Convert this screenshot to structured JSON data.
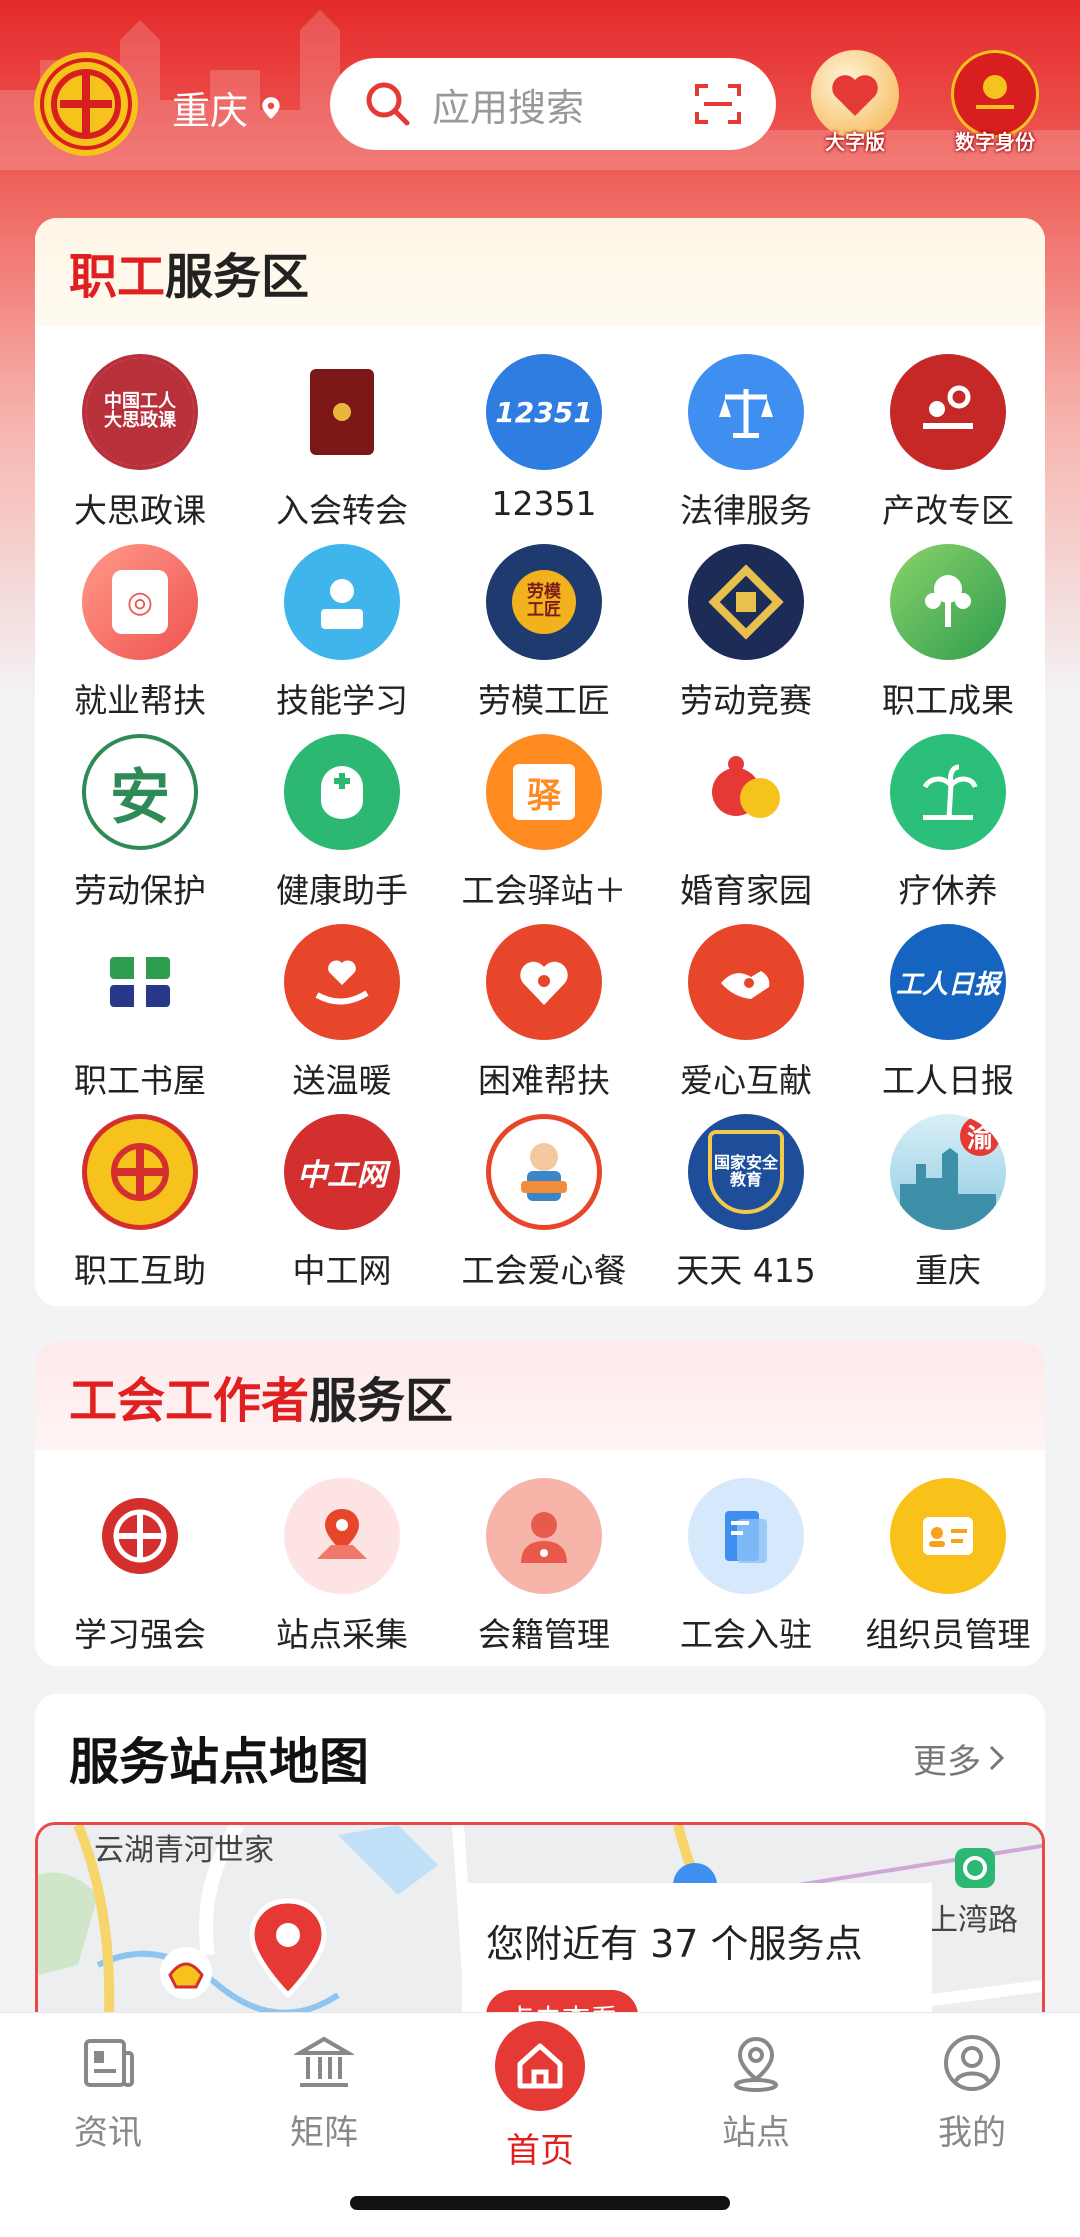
{
  "header": {
    "city": "重庆",
    "search_placeholder": "应用搜索",
    "large_font_label": "大字版",
    "digital_id_label": "数字身份"
  },
  "worker_zone": {
    "title_red": "职工",
    "title_rest": "服务区",
    "items": [
      {
        "label": "大思政课",
        "icon": "ideology-course-icon",
        "text": "中国工人大思政课",
        "color": "#b8303a"
      },
      {
        "label": "入会转会",
        "icon": "membership-book-icon",
        "color": "#8b1a1a"
      },
      {
        "label": "12351",
        "icon": "hotline-12351-icon",
        "text": "12351",
        "color": "#2f7de1"
      },
      {
        "label": "法律服务",
        "icon": "scale-icon",
        "color": "#3f8ff0"
      },
      {
        "label": "产改专区",
        "icon": "industry-reform-icon",
        "color": "#c62828"
      },
      {
        "label": "就业帮扶",
        "icon": "employment-icon",
        "color": "#f26d6d"
      },
      {
        "label": "技能学习",
        "icon": "skill-learning-icon",
        "color": "#3fb5ec"
      },
      {
        "label": "劳模工匠",
        "icon": "model-worker-medal-icon",
        "text": "劳模工匠",
        "color": "#1e3a6e"
      },
      {
        "label": "劳动竞赛",
        "icon": "labor-contest-icon",
        "color": "#1d2b57"
      },
      {
        "label": "职工成果",
        "icon": "worker-achievement-icon",
        "color": "#4caf50"
      },
      {
        "label": "劳动保护",
        "icon": "labor-protection-icon",
        "text": "安",
        "color": "#2e8b57"
      },
      {
        "label": "健康助手",
        "icon": "health-assistant-icon",
        "color": "#2cb872"
      },
      {
        "label": "工会驿站＋",
        "icon": "union-station-icon",
        "text": "驿",
        "color": "#ff8a1f"
      },
      {
        "label": "婚育家园",
        "icon": "marriage-family-icon",
        "color": "#ffffff"
      },
      {
        "label": "疗休养",
        "icon": "recuperation-icon",
        "color": "#2cbf7a"
      },
      {
        "label": "职工书屋",
        "icon": "worker-library-icon",
        "color": "#ffffff"
      },
      {
        "label": "送温暖",
        "icon": "send-warmth-icon",
        "color": "#e8462a"
      },
      {
        "label": "困难帮扶",
        "icon": "hardship-aid-icon",
        "color": "#e8462a"
      },
      {
        "label": "爱心互献",
        "icon": "love-donation-icon",
        "color": "#e8462a"
      },
      {
        "label": "工人日报",
        "icon": "workers-daily-icon",
        "text": "工人日报",
        "color": "#1565c0"
      },
      {
        "label": "职工互助",
        "icon": "mutual-aid-icon",
        "color": "#d32f2f"
      },
      {
        "label": "中工网",
        "icon": "workercn-icon",
        "text": "中工网",
        "color": "#d32f2f"
      },
      {
        "label": "工会爱心餐",
        "icon": "union-meal-icon",
        "color": "#f3c9b6"
      },
      {
        "label": "天天 415",
        "icon": "national-security-icon",
        "text": "国家安全教育",
        "color": "#1e4d9a"
      },
      {
        "label": "重庆",
        "icon": "chongqing-icon",
        "text": "渝",
        "color": "#a8d8e8"
      }
    ]
  },
  "union_worker_zone": {
    "title_red": "工会工作者",
    "title_rest": "服务区",
    "items": [
      {
        "label": "学习强会",
        "icon": "study-union-icon",
        "color": "#d32f2f"
      },
      {
        "label": "站点采集",
        "icon": "site-collect-icon",
        "color": "#fde3e3"
      },
      {
        "label": "会籍管理",
        "icon": "membership-manage-icon",
        "color": "#f7b4a8"
      },
      {
        "label": "工会入驻",
        "icon": "union-settle-icon",
        "color": "#d6e8fb"
      },
      {
        "label": "组织员管理",
        "icon": "organizer-manage-icon",
        "color": "#f8c21b"
      }
    ]
  },
  "map_section": {
    "title": "服务站点地图",
    "more": "更多",
    "place_label_1": "云湖青河世家",
    "place_label_2": "上湾路",
    "popup_text": "您附近有 37 个服务点",
    "popup_button": "点击查看"
  },
  "tabbar": {
    "items": [
      {
        "label": "资讯",
        "icon": "news-icon"
      },
      {
        "label": "矩阵",
        "icon": "matrix-icon"
      },
      {
        "label": "首页",
        "icon": "home-icon",
        "active": true
      },
      {
        "label": "站点",
        "icon": "station-icon"
      },
      {
        "label": "我的",
        "icon": "profile-icon"
      }
    ]
  }
}
